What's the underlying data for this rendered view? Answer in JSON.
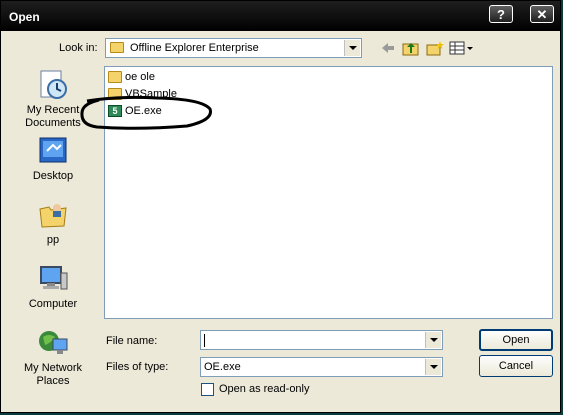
{
  "window": {
    "title": "Open",
    "help_label": "?",
    "close_label": "✕"
  },
  "look_in": {
    "label": "Look in:",
    "value": "Offline Explorer Enterprise"
  },
  "places": [
    {
      "label": "My Recent Documents",
      "icon": "recent-documents-icon"
    },
    {
      "label": "Desktop",
      "icon": "desktop-icon"
    },
    {
      "label": "pp",
      "icon": "user-folder-icon"
    },
    {
      "label": "Computer",
      "icon": "computer-icon"
    },
    {
      "label": "My Network Places",
      "icon": "network-places-icon"
    }
  ],
  "files": [
    {
      "name": "oe ole",
      "type": "folder"
    },
    {
      "name": "VBSample",
      "type": "folder"
    },
    {
      "name": "OE.exe",
      "type": "exe",
      "icon_text": "5"
    }
  ],
  "file_name": {
    "label": "File name:",
    "value": ""
  },
  "file_type": {
    "label": "Files of type:",
    "value": "OE.exe"
  },
  "read_only": {
    "label": "Open as read-only",
    "checked": false
  },
  "buttons": {
    "open": "Open",
    "cancel": "Cancel"
  },
  "colors": {
    "titlebar": "#000000",
    "dialog_bg": "#ece9d8",
    "desktop_bg": "#0b3b3b",
    "annotation": "#000000"
  }
}
